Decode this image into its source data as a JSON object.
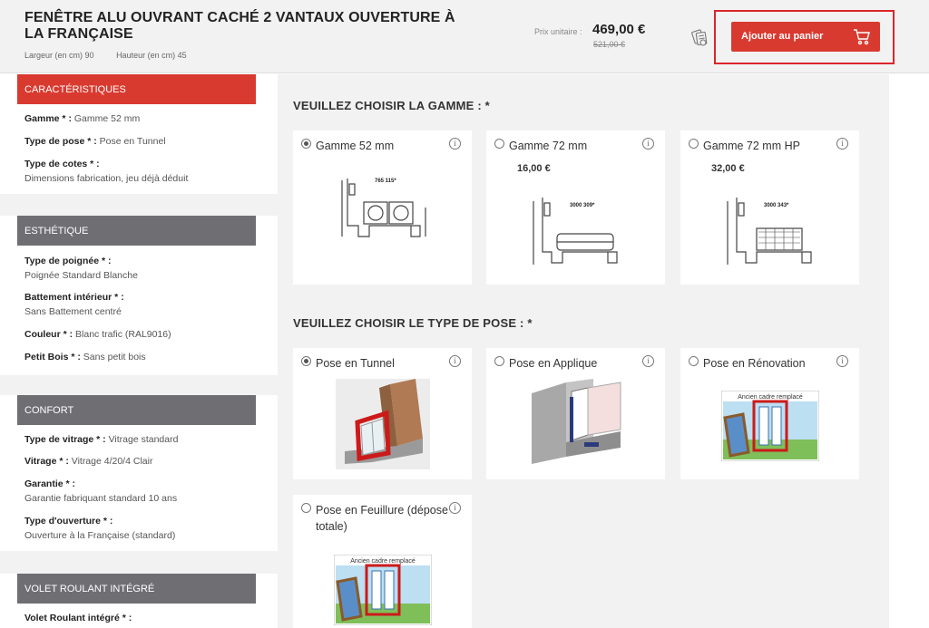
{
  "header": {
    "title": "FENÊTRE ALU OUVRANT CACHÉ 2 VANTAUX OUVERTURE À LA FRANÇAISE",
    "width_label": "Largeur (en cm) 90",
    "height_label": "Hauteur (en cm) 45",
    "price_label": "Prix unitaire :",
    "price": "469,00 €",
    "old_price": "521,00 €",
    "cart_button": "Ajouter au panier"
  },
  "sidebar": {
    "sections": [
      {
        "title": "CARACTÉRISTIQUES"
      },
      {
        "title": "ESTHÉTIQUE"
      },
      {
        "title": "CONFORT"
      },
      {
        "title": "VOLET ROULANT INTÉGRÉ"
      }
    ],
    "specs": {
      "gamme_k": "Gamme * :",
      "gamme_v": "Gamme 52 mm",
      "pose_k": "Type de pose * :",
      "pose_v": "Pose en Tunnel",
      "cotes_k": "Type de cotes * :",
      "cotes_v": "Dimensions fabrication, jeu déjà déduit",
      "poignee_k": "Type de poignée * :",
      "poignee_v": "Poignée Standard Blanche",
      "battement_k": "Battement intérieur * :",
      "battement_v": "Sans Battement centré",
      "couleur_k": "Couleur * :",
      "couleur_v": "Blanc trafic (RAL9016)",
      "petitbois_k": "Petit Bois * :",
      "petitbois_v": "Sans petit bois",
      "vitrage_type_k": "Type de vitrage * :",
      "vitrage_type_v": "Vitrage standard",
      "vitrage_k": "Vitrage * :",
      "vitrage_v": "Vitrage 4/20/4 Clair",
      "garantie_k": "Garantie * :",
      "garantie_v": "Garantie fabriquant standard 10 ans",
      "ouverture_k": "Type d'ouverture * :",
      "ouverture_v": "Ouverture à la Française (standard)",
      "volet_k": "Volet Roulant intégré * :"
    }
  },
  "main": {
    "gamme_title": "VEUILLEZ CHOISIR LA GAMME : *",
    "gamme_options": [
      {
        "label": "Gamme 52 mm",
        "price": "",
        "selected": true,
        "profile_code": "765 115*"
      },
      {
        "label": "Gamme 72 mm",
        "price": "16,00 €",
        "selected": false,
        "profile_code": "3000 309*"
      },
      {
        "label": "Gamme 72 mm HP",
        "price": "32,00 €",
        "selected": false,
        "profile_code": "3000 343*"
      }
    ],
    "pose_title": "VEUILLEZ CHOISIR LE TYPE DE POSE : *",
    "pose_options": [
      {
        "label": "Pose en Tunnel",
        "selected": true
      },
      {
        "label": "Pose en Applique",
        "selected": false
      },
      {
        "label": "Pose en Rénovation",
        "selected": false,
        "caption": "Ancien cadre remplacé"
      },
      {
        "label": "Pose en Feuillure (dépose totale)",
        "selected": false,
        "caption": "Ancien cadre remplacé"
      }
    ]
  },
  "colors": {
    "accent": "#d93a30",
    "section_grey": "#6f6e73",
    "background": "#f2f2f2"
  },
  "icons": {
    "quote": "quote-calculator-icon",
    "cart": "shopping-cart-icon",
    "info": "info-icon"
  }
}
